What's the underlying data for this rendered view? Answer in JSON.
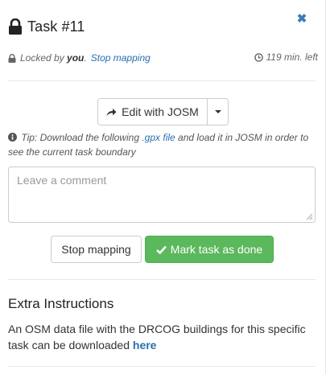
{
  "task": {
    "title": "Task #11",
    "close_glyph": "✖",
    "locked_prefix": "Locked by",
    "locked_user": "you",
    "locked_suffix": ".",
    "stop_link": "Stop mapping",
    "time_left": "119 min. left"
  },
  "editor": {
    "button_label": "Edit with JOSM"
  },
  "tip": {
    "prefix": "Tip: Download the following",
    "gpx_link": ".gpx file",
    "suffix": "and load it in JOSM in order to see the current task boundary"
  },
  "comment": {
    "placeholder": "Leave a comment",
    "value": ""
  },
  "actions": {
    "stop_label": "Stop mapping",
    "done_label": "Mark task as done"
  },
  "extra": {
    "title": "Extra Instructions",
    "text": "An OSM data file with the DRCOG buildings for this specific task can be downloaded",
    "link": "here"
  },
  "icons": {
    "lock": "lock-icon",
    "close": "close-icon",
    "clock": "clock-icon",
    "share": "share-arrow-icon",
    "caret": "caret-down-icon",
    "info": "info-icon",
    "check": "check-icon"
  },
  "colors": {
    "link": "#2a6fb0",
    "close": "#3c7dbb",
    "success": "#5cb85c",
    "border": "#cccccc"
  }
}
